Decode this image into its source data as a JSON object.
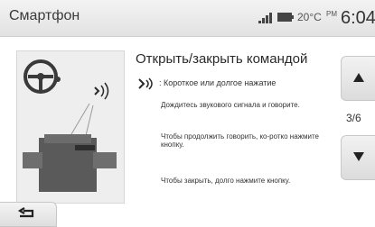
{
  "header": {
    "title": "Смартфон",
    "temperature": "20°C",
    "ampm": "PM",
    "time": "6:04",
    "icons": [
      "signal-icon",
      "battery-icon"
    ]
  },
  "content": {
    "heading": "Открыть/закрыть командой",
    "voice_hint": ": Короткое или долгое нажатие",
    "paragraphs": [
      "Дождитесь звукового сигнала и говорите.",
      "Чтобы продолжить говорить, ко-ротко нажмите кнопку.",
      "Чтобы закрыть, долго нажмите кнопку."
    ]
  },
  "navigation": {
    "page_indicator": "3/6",
    "up_icon": "arrow-up-icon",
    "down_icon": "arrow-down-icon",
    "back_icon": "back-arrow-icon"
  },
  "illustration": {
    "icons": [
      "steering-wheel-icon",
      "voice-wave-icon",
      "steering-column-switch-icon"
    ]
  }
}
